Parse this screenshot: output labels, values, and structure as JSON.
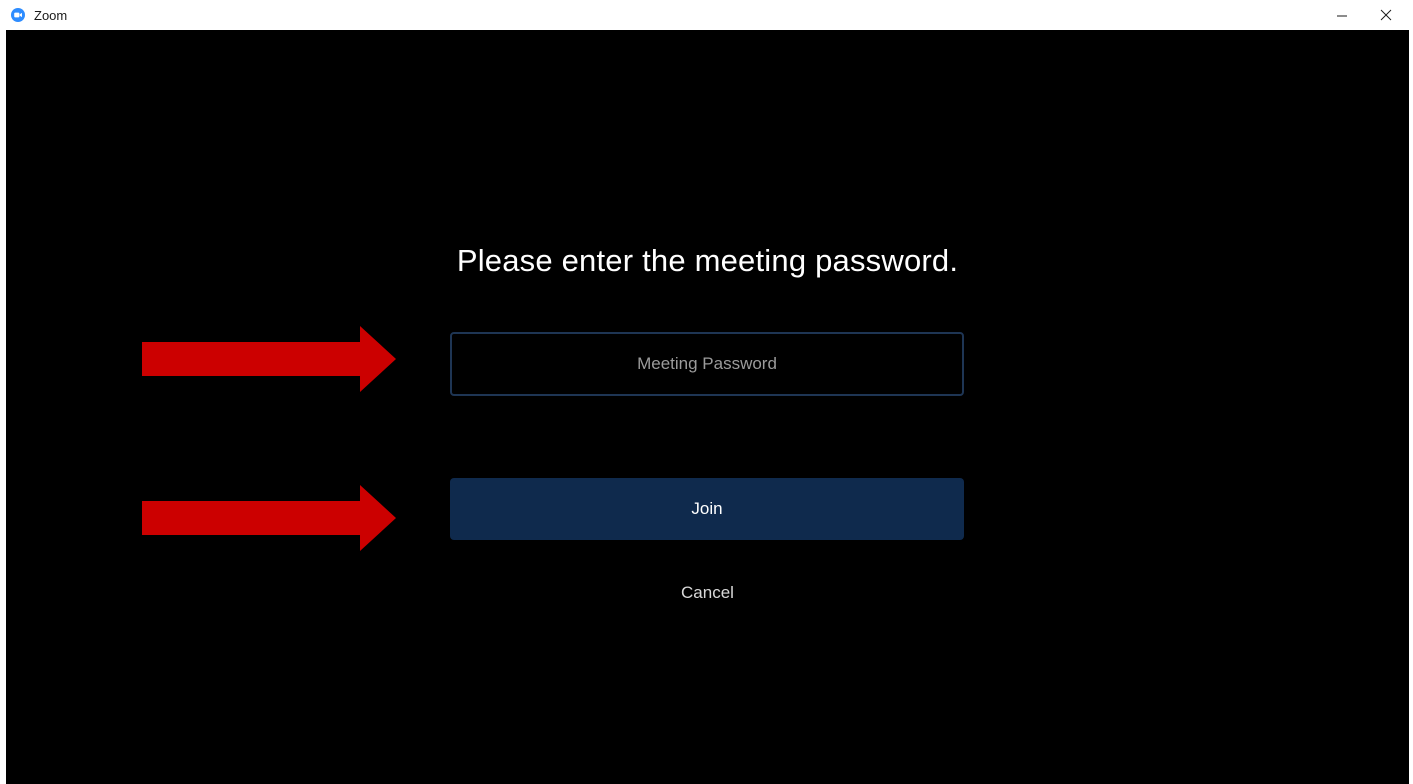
{
  "window": {
    "title": "Zoom",
    "icon": "zoom-logo-icon"
  },
  "dialog": {
    "prompt": "Please enter the meeting password.",
    "password_placeholder": "Meeting Password",
    "password_value": "",
    "join_label": "Join",
    "cancel_label": "Cancel"
  },
  "annotations": {
    "arrow_icon": "right-arrow-icon",
    "arrow_color": "#cc0000"
  },
  "colors": {
    "background": "#000000",
    "join_button": "#0f2a4d",
    "input_border": "#1e3554",
    "brand": "#2d8cff"
  }
}
